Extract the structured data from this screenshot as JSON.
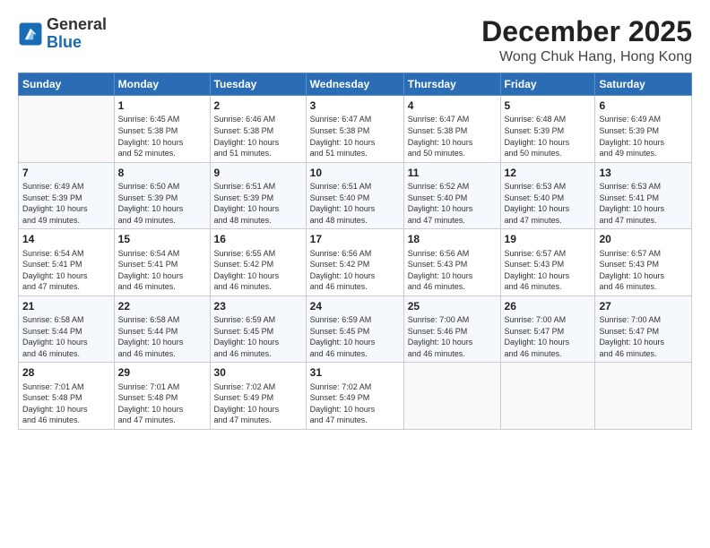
{
  "header": {
    "logo_line1": "General",
    "logo_line2": "Blue",
    "title": "December 2025",
    "subtitle": "Wong Chuk Hang, Hong Kong"
  },
  "weekdays": [
    "Sunday",
    "Monday",
    "Tuesday",
    "Wednesday",
    "Thursday",
    "Friday",
    "Saturday"
  ],
  "weeks": [
    [
      {
        "day": "",
        "info": ""
      },
      {
        "day": "1",
        "info": "Sunrise: 6:45 AM\nSunset: 5:38 PM\nDaylight: 10 hours\nand 52 minutes."
      },
      {
        "day": "2",
        "info": "Sunrise: 6:46 AM\nSunset: 5:38 PM\nDaylight: 10 hours\nand 51 minutes."
      },
      {
        "day": "3",
        "info": "Sunrise: 6:47 AM\nSunset: 5:38 PM\nDaylight: 10 hours\nand 51 minutes."
      },
      {
        "day": "4",
        "info": "Sunrise: 6:47 AM\nSunset: 5:38 PM\nDaylight: 10 hours\nand 50 minutes."
      },
      {
        "day": "5",
        "info": "Sunrise: 6:48 AM\nSunset: 5:39 PM\nDaylight: 10 hours\nand 50 minutes."
      },
      {
        "day": "6",
        "info": "Sunrise: 6:49 AM\nSunset: 5:39 PM\nDaylight: 10 hours\nand 49 minutes."
      }
    ],
    [
      {
        "day": "7",
        "info": "Sunrise: 6:49 AM\nSunset: 5:39 PM\nDaylight: 10 hours\nand 49 minutes."
      },
      {
        "day": "8",
        "info": "Sunrise: 6:50 AM\nSunset: 5:39 PM\nDaylight: 10 hours\nand 49 minutes."
      },
      {
        "day": "9",
        "info": "Sunrise: 6:51 AM\nSunset: 5:39 PM\nDaylight: 10 hours\nand 48 minutes."
      },
      {
        "day": "10",
        "info": "Sunrise: 6:51 AM\nSunset: 5:40 PM\nDaylight: 10 hours\nand 48 minutes."
      },
      {
        "day": "11",
        "info": "Sunrise: 6:52 AM\nSunset: 5:40 PM\nDaylight: 10 hours\nand 47 minutes."
      },
      {
        "day": "12",
        "info": "Sunrise: 6:53 AM\nSunset: 5:40 PM\nDaylight: 10 hours\nand 47 minutes."
      },
      {
        "day": "13",
        "info": "Sunrise: 6:53 AM\nSunset: 5:41 PM\nDaylight: 10 hours\nand 47 minutes."
      }
    ],
    [
      {
        "day": "14",
        "info": "Sunrise: 6:54 AM\nSunset: 5:41 PM\nDaylight: 10 hours\nand 47 minutes."
      },
      {
        "day": "15",
        "info": "Sunrise: 6:54 AM\nSunset: 5:41 PM\nDaylight: 10 hours\nand 46 minutes."
      },
      {
        "day": "16",
        "info": "Sunrise: 6:55 AM\nSunset: 5:42 PM\nDaylight: 10 hours\nand 46 minutes."
      },
      {
        "day": "17",
        "info": "Sunrise: 6:56 AM\nSunset: 5:42 PM\nDaylight: 10 hours\nand 46 minutes."
      },
      {
        "day": "18",
        "info": "Sunrise: 6:56 AM\nSunset: 5:43 PM\nDaylight: 10 hours\nand 46 minutes."
      },
      {
        "day": "19",
        "info": "Sunrise: 6:57 AM\nSunset: 5:43 PM\nDaylight: 10 hours\nand 46 minutes."
      },
      {
        "day": "20",
        "info": "Sunrise: 6:57 AM\nSunset: 5:43 PM\nDaylight: 10 hours\nand 46 minutes."
      }
    ],
    [
      {
        "day": "21",
        "info": "Sunrise: 6:58 AM\nSunset: 5:44 PM\nDaylight: 10 hours\nand 46 minutes."
      },
      {
        "day": "22",
        "info": "Sunrise: 6:58 AM\nSunset: 5:44 PM\nDaylight: 10 hours\nand 46 minutes."
      },
      {
        "day": "23",
        "info": "Sunrise: 6:59 AM\nSunset: 5:45 PM\nDaylight: 10 hours\nand 46 minutes."
      },
      {
        "day": "24",
        "info": "Sunrise: 6:59 AM\nSunset: 5:45 PM\nDaylight: 10 hours\nand 46 minutes."
      },
      {
        "day": "25",
        "info": "Sunrise: 7:00 AM\nSunset: 5:46 PM\nDaylight: 10 hours\nand 46 minutes."
      },
      {
        "day": "26",
        "info": "Sunrise: 7:00 AM\nSunset: 5:47 PM\nDaylight: 10 hours\nand 46 minutes."
      },
      {
        "day": "27",
        "info": "Sunrise: 7:00 AM\nSunset: 5:47 PM\nDaylight: 10 hours\nand 46 minutes."
      }
    ],
    [
      {
        "day": "28",
        "info": "Sunrise: 7:01 AM\nSunset: 5:48 PM\nDaylight: 10 hours\nand 46 minutes."
      },
      {
        "day": "29",
        "info": "Sunrise: 7:01 AM\nSunset: 5:48 PM\nDaylight: 10 hours\nand 47 minutes."
      },
      {
        "day": "30",
        "info": "Sunrise: 7:02 AM\nSunset: 5:49 PM\nDaylight: 10 hours\nand 47 minutes."
      },
      {
        "day": "31",
        "info": "Sunrise: 7:02 AM\nSunset: 5:49 PM\nDaylight: 10 hours\nand 47 minutes."
      },
      {
        "day": "",
        "info": ""
      },
      {
        "day": "",
        "info": ""
      },
      {
        "day": "",
        "info": ""
      }
    ]
  ]
}
